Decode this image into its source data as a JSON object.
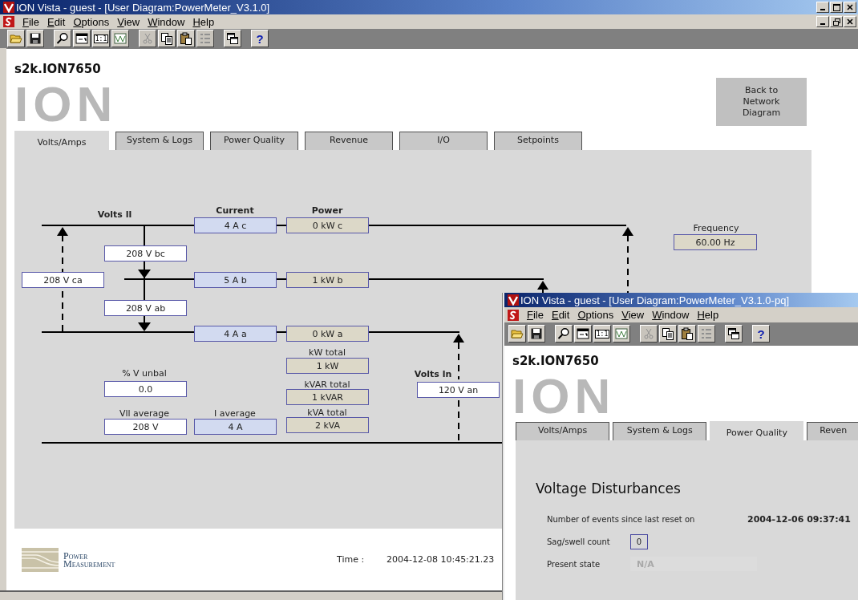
{
  "windows": [
    {
      "title": "ION Vista - guest - [User Diagram:PowerMeter_V3.1.0]",
      "menu": [
        "File",
        "Edit",
        "Options",
        "View",
        "Window",
        "Help"
      ],
      "toolbar": [
        {
          "disabled": false
        },
        {
          "disabled": false
        },
        {
          "disabled": false
        },
        {
          "disabled": false
        },
        {
          "label": "1:1",
          "disabled": false
        },
        {
          "disabled": false
        },
        {
          "disabled": true
        },
        {
          "disabled": false
        },
        {
          "disabled": false
        },
        {
          "disabled": true
        },
        {
          "disabled": false
        },
        {
          "label": "?",
          "disabled": false
        }
      ],
      "device": "s2k.ION7650",
      "logo": "ION",
      "tabs": [
        {
          "label": "Volts/Amps",
          "selected": true
        },
        {
          "label": "System & Logs",
          "selected": false
        },
        {
          "label": "Power Quality",
          "selected": false
        },
        {
          "label": "Revenue",
          "selected": false
        },
        {
          "label": "I/O",
          "selected": false
        },
        {
          "label": "Setpoints",
          "selected": false
        }
      ]
    },
    {
      "title": "ION Vista - guest - [User Diagram:PowerMeter_V3.1.0-pq]",
      "menu": [
        "File",
        "Edit",
        "Options",
        "View",
        "Window",
        "Help"
      ],
      "toolbar": [
        {
          "disabled": false
        },
        {
          "disabled": false
        },
        {
          "disabled": false
        },
        {
          "disabled": false
        },
        {
          "label": "1:1",
          "disabled": false
        },
        {
          "disabled": false
        },
        {
          "disabled": true
        },
        {
          "disabled": false
        },
        {
          "disabled": false
        },
        {
          "disabled": true
        },
        {
          "disabled": false
        },
        {
          "label": "?",
          "disabled": false
        }
      ],
      "device": "s2k.ION7650",
      "logo": "ION",
      "tabs": [
        {
          "label": "Volts/Amps",
          "selected": false
        },
        {
          "label": "System & Logs",
          "selected": false
        },
        {
          "label": "Power Quality",
          "selected": true
        },
        {
          "label": "Reven",
          "selected": false
        }
      ]
    }
  ],
  "back_button": "Back to Network Diagram",
  "diagram": {
    "volts_ll_label": "Volts ll",
    "current_label": "Current",
    "power_label": "Power",
    "voltages": [
      "208 V bc",
      "208 V ca",
      "208 V ab"
    ],
    "currents": [
      "4 A c",
      "5 A b",
      "4 A a"
    ],
    "powers": [
      "0 kW c",
      "1 kW b",
      "0 kW a"
    ],
    "totals": [
      {
        "label": "kW total",
        "value": "1 kW"
      },
      {
        "label": "kVAR total",
        "value": "1 kVAR"
      },
      {
        "label": "kVA total",
        "value": "2 kVA"
      }
    ],
    "v_unbal": {
      "label": "% V unbal",
      "value": "0.0"
    },
    "vll_average": {
      "label": "Vll average",
      "value": "208 V"
    },
    "i_average": {
      "label": "I average",
      "value": "4 A"
    },
    "volts_ln": {
      "label": "Volts ln",
      "value": "120 V an"
    },
    "frequency": {
      "label": "Frequency",
      "value": "60.00 Hz"
    }
  },
  "footer": {
    "company": "Power Measurement",
    "time_label": "Time :",
    "time": "2004-12-08 10:45:21.23"
  },
  "power_quality": {
    "heading": "Voltage Disturbances",
    "reset_label": "Number of events since last reset on",
    "reset_time": "2004-12-06 09:37:41",
    "sag_swell": {
      "label": "Sag/swell count",
      "value": "0"
    },
    "present_state": {
      "label": "Present state",
      "value": "N/A",
      "disabled": true
    }
  }
}
